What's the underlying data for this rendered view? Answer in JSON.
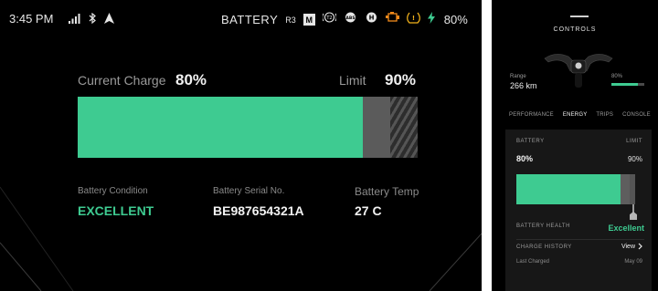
{
  "dashboard": {
    "status_bar": {
      "time": "3:45 PM",
      "battery_label": "BATTERY",
      "ride_mode": "R3",
      "mode_badge": "M",
      "battery_percent": "80%",
      "icons": [
        "signal-icon",
        "bluetooth-icon",
        "navigation-icon",
        "traction-control-icon",
        "abs-icon",
        "high-beam-icon",
        "engine-warning-icon",
        "tire-pressure-warning-icon",
        "charging-bolt-icon"
      ]
    },
    "current_charge": {
      "label": "Current Charge",
      "value": "80%"
    },
    "limit": {
      "label": "Limit",
      "value": "90%"
    },
    "charge_bar": {
      "charge_fraction": 0.84,
      "limit_fraction": 0.92
    },
    "battery_condition": {
      "label": "Battery Condition",
      "value": "EXCELLENT"
    },
    "battery_serial": {
      "label": "Battery Serial No.",
      "value": "BE987654321A"
    },
    "battery_temp": {
      "label": "Battery Temp",
      "value": "27 C"
    },
    "colors": {
      "accent": "#3ecb91",
      "background": "#000000"
    }
  },
  "phone": {
    "title": "CONTROLS",
    "range": {
      "label": "Range",
      "value": "266 km"
    },
    "battery_mini": {
      "label": "80%",
      "fraction": 0.8
    },
    "tabs": [
      {
        "label": "PERFORMANCE",
        "active": false
      },
      {
        "label": "ENERGY",
        "active": true
      },
      {
        "label": "TRIPS",
        "active": false
      },
      {
        "label": "CONSOLE",
        "active": false
      }
    ],
    "card": {
      "battery_label": "BATTERY",
      "limit_label": "LIMIT",
      "battery_value": "80%",
      "limit_value": "90%",
      "bar": {
        "charge_fraction": 0.88,
        "limit_fraction": 0.95
      },
      "health_label": "BATTERY HEALTH",
      "health_value": "Excellent",
      "history_label": "CHARGE HISTORY",
      "view_label": "View",
      "last_charged_label": "Last Charged",
      "last_charged_value": "May 09"
    }
  }
}
